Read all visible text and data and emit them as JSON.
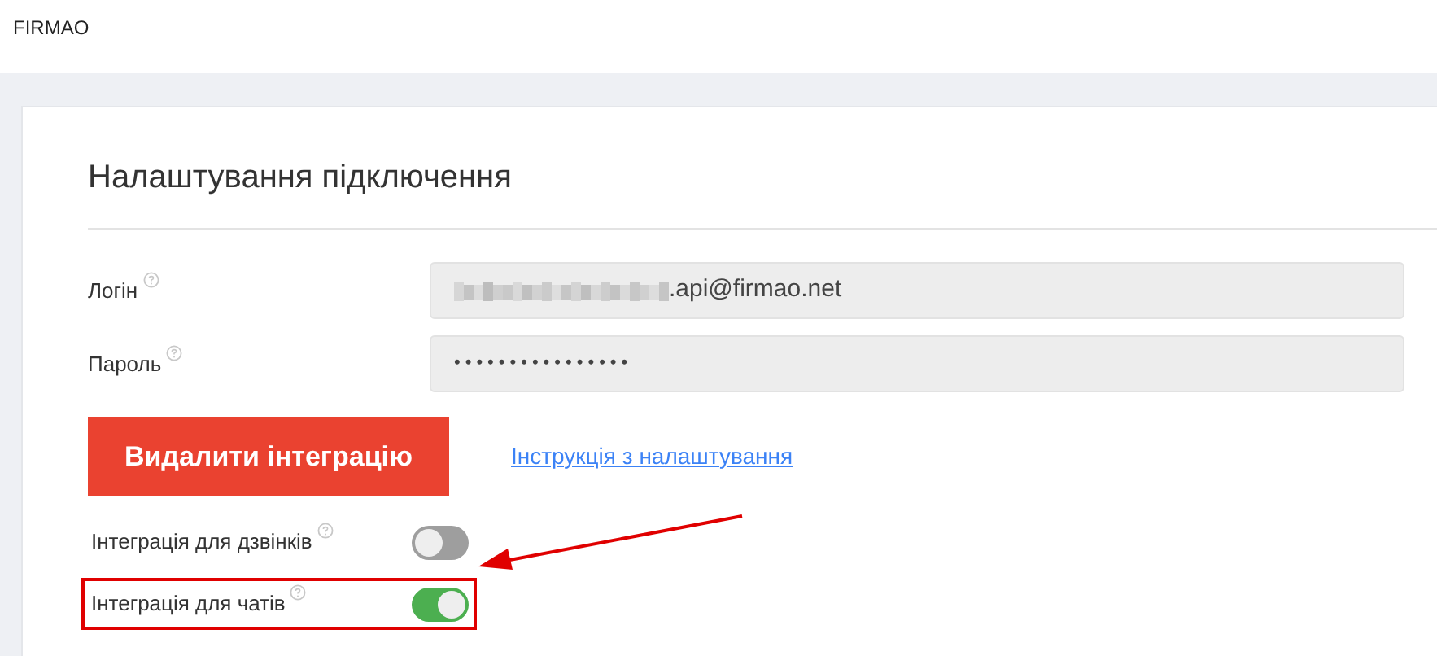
{
  "header": {
    "brand": "FIRMAO"
  },
  "card": {
    "title": "Налаштування підключення",
    "fields": [
      {
        "label": "Логін",
        "value": ".api@firmao.net",
        "redacted": true
      },
      {
        "label": "Пароль",
        "value": "••••••••••••••••",
        "redacted": false
      }
    ],
    "delete_button": "Видалити інтеграцію",
    "help_link": "Інструкція з налаштування",
    "toggles": [
      {
        "label": "Інтеграція для дзвінків",
        "on": false,
        "highlighted": false
      },
      {
        "label": "Інтеграція для чатів",
        "on": true,
        "highlighted": true
      }
    ]
  }
}
